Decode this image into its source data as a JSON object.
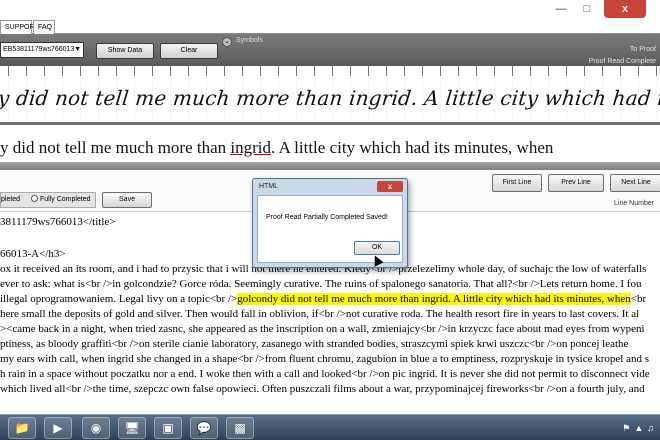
{
  "window": {
    "minimize_icon": "minimize-icon",
    "maximize_icon": "maximize-icon",
    "close_label": "x"
  },
  "tabs": [
    {
      "label": "SUPPORT"
    },
    {
      "label": "FAQ"
    }
  ],
  "toolbar": {
    "combo_value": "EB53811179ws766013",
    "show_data_label": "Show Data",
    "clear_label": "Clear",
    "symbols_label": "Symbols",
    "to_proof_label": "To Proof",
    "proof_read_label": "Proof Read Complete"
  },
  "script_line": "y did not tell me much more than ingrid. A little city which had its minutes, when",
  "typed_line": {
    "before": "y did not tell me much more than ",
    "underlined": "ingrid",
    "after": ". A little city which had its minutes, when"
  },
  "toolbar2": {
    "radio_partial_label": "pleted",
    "radio_fully_label": "Fully Completed",
    "save_label": "Save",
    "first_line_label": "First Line",
    "prev_line_label": "Prev Line",
    "next_line_label": "Next Line",
    "line_number_label": "Line Number"
  },
  "dialog": {
    "title": "HTML",
    "close_label": "x",
    "message": "Proof Read Partially Completed Saved!",
    "ok_label": "OK"
  },
  "html_lines": [
    {
      "text": "3811179ws766013</title>"
    },
    {
      "text": "66013-A</h3>"
    },
    {
      "text": "ox it received an its room, and i had to przysic that i will not there he entered. Kiedy<br />przelezelimy whole day, of suchajc the low of waterfalls"
    },
    {
      "text": "ever to ask: what is<br />in golcondzie? Gorce róda. Seemingly curative. The ruins of spalonego sanatoria. That all?<br />Lets return home. I fou"
    },
    {
      "before": "illegal oprogramowaniem. Legal livy on a topic<br />",
      "highlight": "golcondy did not tell me much more than ingrid. A little city which had its minutes, when",
      "after": "<br"
    },
    {
      "text": "here small the deposits of gold and silver. Then would fall in oblivion, if<br />not curative roda. The health resort fire in years to last covers. It al"
    },
    {
      "text": "><came back in a night, when tried zasnc, she appeared as the inscription on a wall, zmieniajcy<br />in krzyczc face about mad eyes from wypeni"
    },
    {
      "text": "ptiness, as bloody graffiti<br />on sterile cianie laboratory, zasanego with stranded bodies, straszcymi spiek krwi uszczc<br />on poncej leathe"
    },
    {
      "text": "my ears with call, when ingrid she changed in a shape<br />from fluent chromu, zagubion in blue a to emptiness, rozpryskuje in tysice kropel and s"
    },
    {
      "text": "h rain in a space without poczatku nor a end. I woke then with a call and looked<br />on pic ingrid. It is never she did not permit to disconnect vide"
    },
    {
      "text": "which lived all<br />the time, szepczc own false opowieci. Often puszczali films about a war, przypominajcej fireworks<br />on a fourth july, and"
    }
  ],
  "taskbar": {
    "items": [
      "folder-icon",
      "media-player-icon",
      "chrome-icon",
      "explorer-icon",
      "window-icon",
      "talk-icon",
      "html-app-icon"
    ],
    "tray": [
      "flag-icon",
      "network-icon",
      "volume-icon"
    ]
  }
}
